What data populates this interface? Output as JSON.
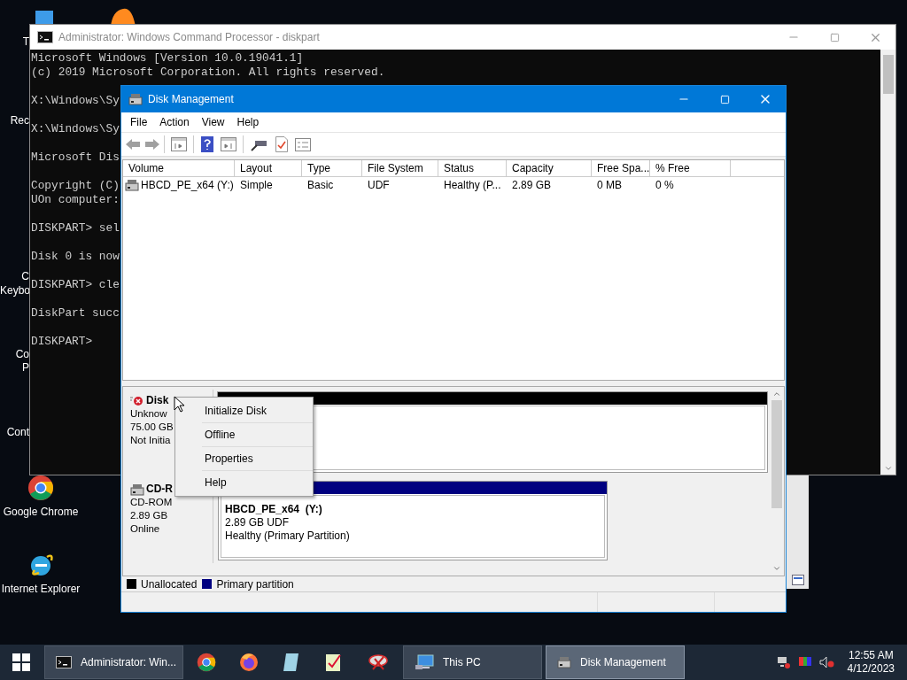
{
  "desktop": {
    "icons": [
      {
        "label": "Google Chrome",
        "kind": "chrome"
      },
      {
        "label": "Internet Explorer",
        "kind": "ie"
      }
    ],
    "cut_labels": [
      "T",
      "Rec",
      "C",
      "Keybo",
      "Co",
      "P",
      "Cont"
    ]
  },
  "console": {
    "title": "Administrator: Windows Command Processor - diskpart",
    "blocks": [
      [
        "Microsoft Windows [Version 10.0.19041.1]",
        "(c) 2019 Microsoft Corporation. All rights reserved."
      ],
      [
        "X:\\Windows\\Sy"
      ],
      [
        "X:\\Windows\\Sy"
      ],
      [
        "Microsoft Dis"
      ],
      [
        "Copyright (C)",
        "UOn computer:"
      ],
      [
        "DISKPART> sel"
      ],
      [
        "Disk 0 is now"
      ],
      [
        "DISKPART> cle"
      ],
      [
        "DiskPart succ"
      ],
      [
        "DISKPART>"
      ]
    ]
  },
  "disk_management": {
    "title": "Disk Management",
    "menu": [
      "File",
      "Action",
      "View",
      "Help"
    ],
    "columns": [
      "Volume",
      "Layout",
      "Type",
      "File System",
      "Status",
      "Capacity",
      "Free Spa...",
      "% Free"
    ],
    "rows": [
      {
        "cells": [
          "HBCD_PE_x64 (Y:)",
          "Simple",
          "Basic",
          "UDF",
          "Healthy (P...",
          "2.89 GB",
          "0 MB",
          "0 %"
        ]
      }
    ],
    "disks": [
      {
        "kind": "error",
        "name": "Disk",
        "lines": [
          "Unknow",
          "75.00 GB",
          "Not Initia"
        ],
        "partitions": [
          {
            "color": "#000000"
          }
        ]
      },
      {
        "kind": "cdrom",
        "name": "CD-R",
        "lines": [
          "CD-ROM",
          "2.89 GB",
          "Online"
        ],
        "partitions": [
          {
            "color": "#000080",
            "name": "HBCD_PE_x64  (Y:)",
            "lines": [
              "2.89 GB UDF",
              "Healthy (Primary Partition)"
            ]
          }
        ]
      }
    ],
    "legend": [
      {
        "label": "Unallocated",
        "color": "#000000"
      },
      {
        "label": "Primary partition",
        "color": "#000080"
      }
    ]
  },
  "context_menu": [
    "Initialize Disk",
    "Offline",
    "Properties",
    "Help"
  ],
  "taskbar": {
    "buttons": [
      {
        "label": "Administrator: Win...",
        "kind": "console",
        "selected": false
      },
      {
        "label": "This PC",
        "kind": "computer",
        "selected": false
      },
      {
        "label": "Disk Management",
        "kind": "disk",
        "selected": true
      }
    ],
    "clock": {
      "time": "12:55 AM",
      "date": "4/12/2023"
    }
  }
}
